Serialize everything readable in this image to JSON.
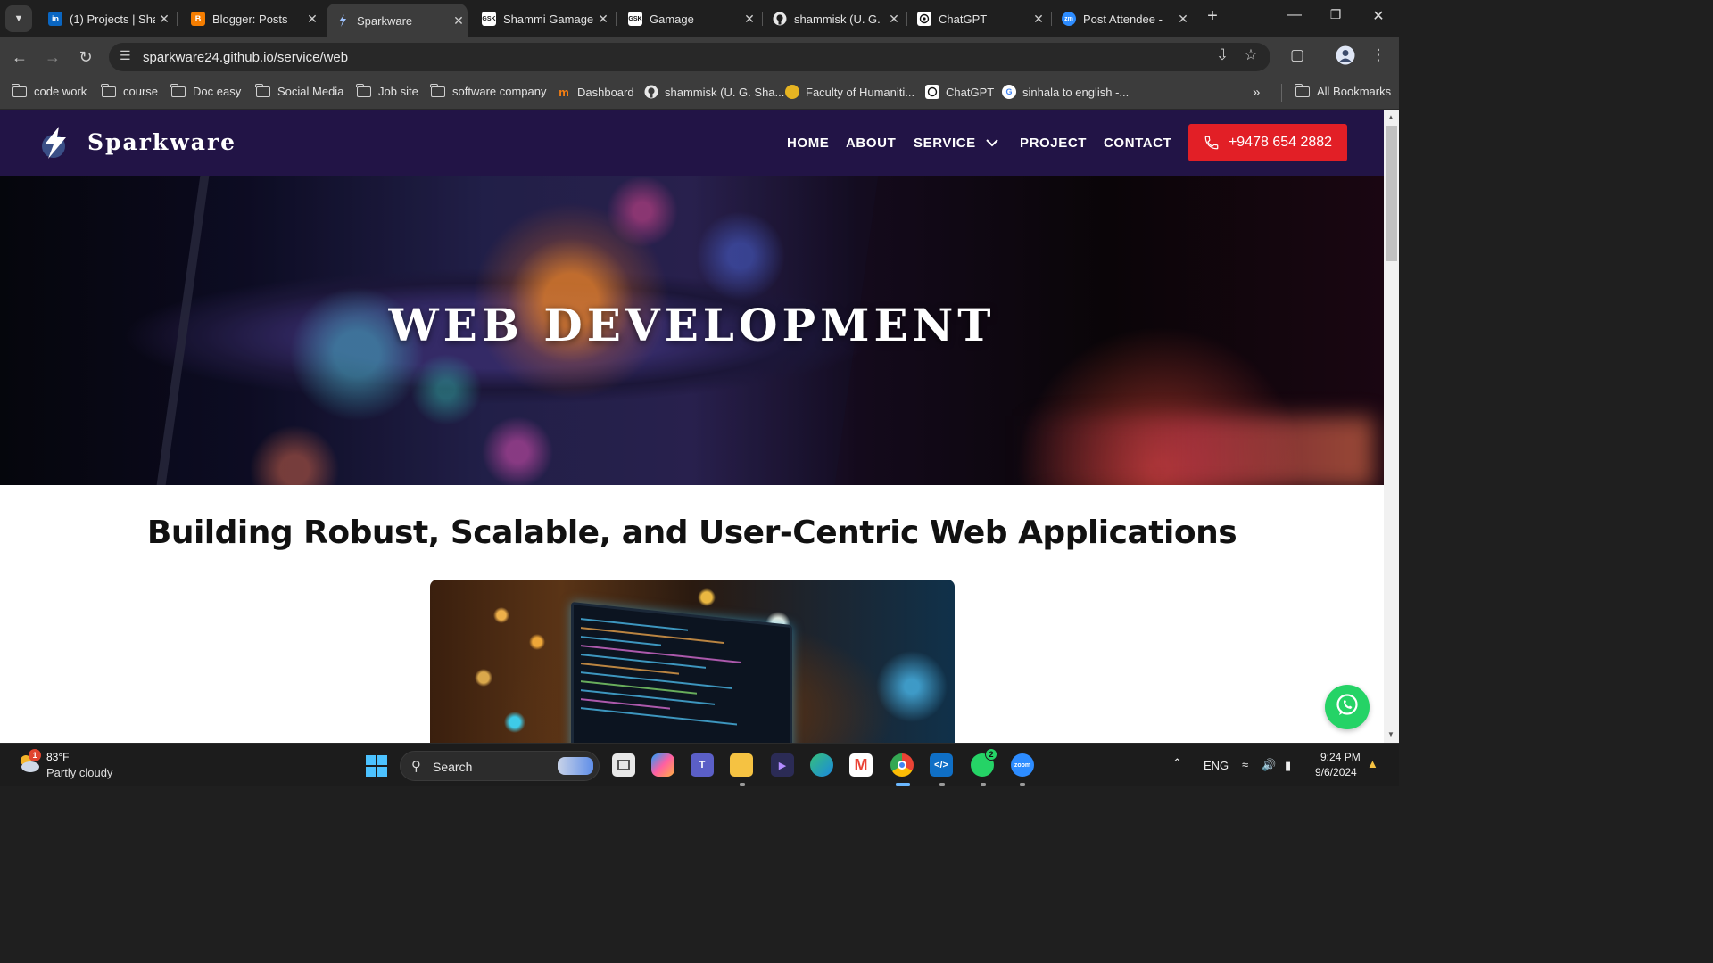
{
  "browser": {
    "tabs": [
      {
        "title": "(1) Projects | Sha",
        "favicon": "linkedin-icon",
        "color": "#0a66c2",
        "active": false
      },
      {
        "title": "Blogger: Posts",
        "favicon": "blogger-icon",
        "color": "#f57d00",
        "active": false
      },
      {
        "title": "Sparkware",
        "favicon": "sparkware-bolt-icon",
        "color": "#2a2a2a",
        "active": true
      },
      {
        "title": "Shammi Gamage",
        "favicon": "gsk-icon",
        "color": "#2a2a2a",
        "active": false
      },
      {
        "title": "Gamage",
        "favicon": "gsk-icon",
        "color": "#2a2a2a",
        "active": false
      },
      {
        "title": "shammisk (U. G.",
        "favicon": "github-icon",
        "color": "#2a2a2a",
        "active": false
      },
      {
        "title": "ChatGPT",
        "favicon": "chatgpt-icon",
        "color": "#2a2a2a",
        "active": false
      },
      {
        "title": "Post Attendee - ",
        "favicon": "zoom-icon",
        "color": "#2d8cff",
        "active": false
      }
    ],
    "url": "sparkware24.github.io/service/web",
    "bookmarks": [
      {
        "label": "code work",
        "type": "folder"
      },
      {
        "label": "course",
        "type": "folder"
      },
      {
        "label": "Doc easy",
        "type": "folder"
      },
      {
        "label": "Social Media",
        "type": "folder"
      },
      {
        "label": "Job site",
        "type": "folder"
      },
      {
        "label": "software company",
        "type": "folder"
      },
      {
        "label": "Dashboard",
        "type": "link",
        "icon": "moodle-icon"
      },
      {
        "label": "shammisk (U. G. Sha...",
        "type": "link",
        "icon": "github-icon"
      },
      {
        "label": "Faculty of Humaniti...",
        "type": "link",
        "icon": "university-icon"
      },
      {
        "label": "ChatGPT",
        "type": "link",
        "icon": "chatgpt-icon"
      },
      {
        "label": "sinhala to english -...",
        "type": "link",
        "icon": "google-icon"
      }
    ],
    "all_bookmarks": "All Bookmarks"
  },
  "site": {
    "brand": "Sparkware",
    "nav": {
      "home": "HOME",
      "about": "ABOUT",
      "service": "SERVICE",
      "project": "PROJECT",
      "contact": "CONTACT"
    },
    "phone": "+9478 654 2882",
    "hero_title": "WEB DEVELOPMENT",
    "section_heading": "Building Robust, Scalable, and User-Centric Web Applications",
    "colors": {
      "nav_bg": "#221446",
      "cta_red": "#e21f26",
      "whatsapp": "#25d366"
    }
  },
  "taskbar": {
    "weather_temp": "83°F",
    "weather_desc": "Partly cloudy",
    "weather_badge": "1",
    "search_label": "Search",
    "whatsapp_badge": "2",
    "lang": "ENG",
    "time": "9:24 PM",
    "date": "9/6/2024"
  }
}
